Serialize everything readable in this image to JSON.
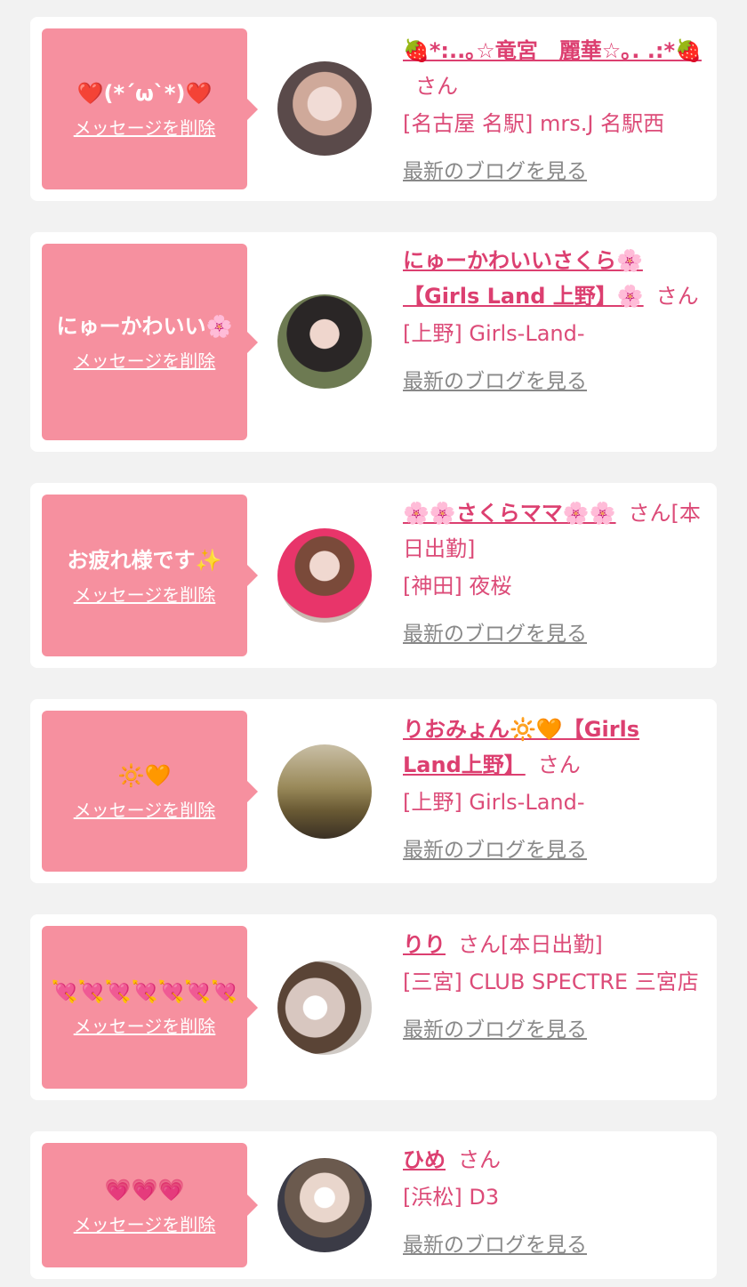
{
  "delete_label": "メッセージを削除",
  "blog_label": "最新のブログを見る",
  "san_label": "さん",
  "colors": {
    "bubble": "#f6909f",
    "name": "#dc3f70",
    "text": "#dc4b78",
    "blog": "#888888"
  },
  "items": [
    {
      "message": "❤️(*´ω`*)❤️",
      "name": "🍓*:..｡☆竜宮　麗華☆｡. .:*🍓",
      "status": "",
      "area": "[名古屋 名駅]",
      "shop": "mrs.J 名駅西"
    },
    {
      "message": "にゅーかわいい🌸",
      "name": "にゅーかわいいさくら🌸【Girls Land 上野】🌸",
      "status": "",
      "area": "[上野]",
      "shop": "Girls-Land-"
    },
    {
      "message": "お疲れ様です✨",
      "name": "🌸🌸さくらママ🌸🌸",
      "status": "[本日出勤]",
      "area": "[神田]",
      "shop": "夜桜"
    },
    {
      "message": "🔆🧡",
      "name": "りおみょん🔆🧡【Girls Land上野】",
      "status": "",
      "area": "[上野]",
      "shop": "Girls-Land-"
    },
    {
      "message": "💘💘💘💘💘💘💘",
      "name": "りり",
      "status": "[本日出勤]",
      "area": "[三宮]",
      "shop": "CLUB SPECTRE 三宮店"
    },
    {
      "message": "💗💗💗",
      "name": "ひめ",
      "status": "",
      "area": "[浜松]",
      "shop": "D3"
    }
  ]
}
